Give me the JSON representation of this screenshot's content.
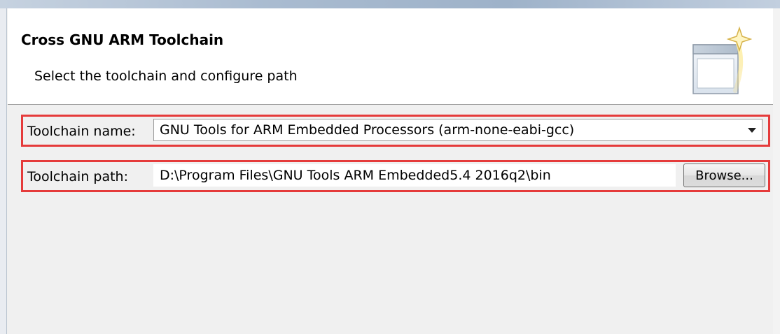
{
  "header": {
    "title": "Cross GNU ARM Toolchain",
    "subtitle": "Select the toolchain and configure path"
  },
  "form": {
    "toolchain_name_label": "Toolchain name:",
    "toolchain_name_value": "GNU Tools for ARM Embedded Processors (arm-none-eabi-gcc)",
    "toolchain_path_label": "Toolchain path:",
    "toolchain_path_value": "D:\\Program Files\\GNU Tools ARM Embedded5.4 2016q2\\bin",
    "browse_label": "Browse..."
  },
  "icons": {
    "wizard_banner": "wizard-window-sparkle-icon",
    "dropdown": "chevron-down-icon"
  },
  "colors": {
    "highlight": "#e53b3b",
    "header_bg": "#ffffff",
    "content_bg": "#f0f0f0"
  }
}
